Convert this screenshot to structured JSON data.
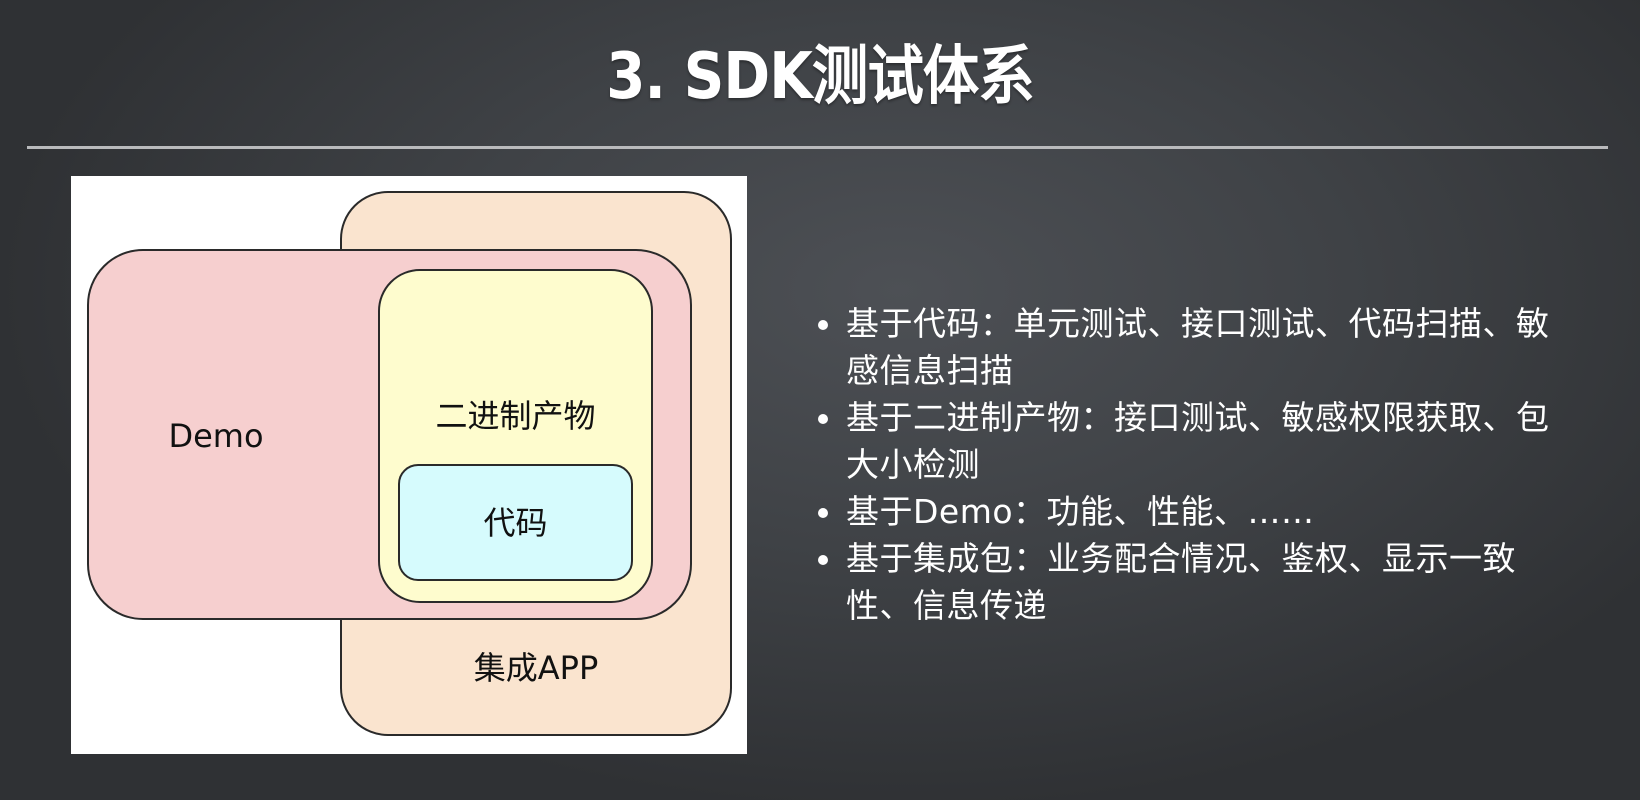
{
  "title": "3. SDK测试体系",
  "diagram": {
    "demo_label": "Demo",
    "binary_label": "二进制产物",
    "code_label": "代码",
    "app_label": "集成APP"
  },
  "bullets": [
    {
      "lines": [
        "基于代码：单元测试、接口测试、代码扫描、敏",
        "感信息扫描"
      ]
    },
    {
      "lines": [
        "基于二进制产物：接口测试、敏感权限获取、包",
        "大小检测"
      ]
    },
    {
      "lines": [
        "基于Demo：功能、性能、……"
      ]
    },
    {
      "lines": [
        "基于集成包：业务配合情况、鉴权、显示一致",
        "性、信息传递"
      ]
    }
  ],
  "colors": {
    "app_fill": "#fae4cf",
    "demo_fill": "#f6cfcf",
    "binary_fill": "#fefcce",
    "code_fill": "#d6fbfd",
    "background": "#3f4246",
    "rule": "#b9babc"
  }
}
